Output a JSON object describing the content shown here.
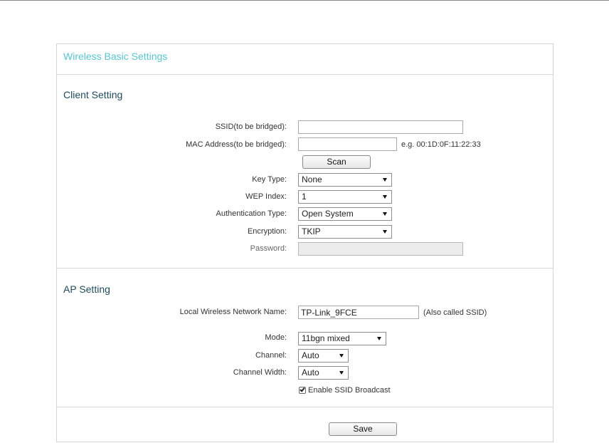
{
  "page": {
    "title": "Wireless Basic Settings"
  },
  "client": {
    "section_title": "Client Setting",
    "ssid_label": "SSID(to be bridged):",
    "ssid_value": "",
    "mac_label": "MAC Address(to be bridged):",
    "mac_value": "",
    "mac_hint": "e.g. 00:1D:0F:11:22:33",
    "scan_label": "Scan",
    "key_type_label": "Key Type:",
    "key_type_value": "None",
    "wep_index_label": "WEP Index:",
    "wep_index_value": "1",
    "auth_type_label": "Authentication Type:",
    "auth_type_value": "Open System",
    "encryption_label": "Encryption:",
    "encryption_value": "TKIP",
    "password_label": "Password:",
    "password_value": ""
  },
  "ap": {
    "section_title": "AP Setting",
    "network_name_label": "Local Wireless Network Name:",
    "network_name_value": "TP-Link_9FCE",
    "network_name_hint": "(Also called SSID)",
    "mode_label": "Mode:",
    "mode_value": "11bgn mixed",
    "channel_label": "Channel:",
    "channel_value": "Auto",
    "channel_width_label": "Channel Width:",
    "channel_width_value": "Auto",
    "broadcast_label": "Enable SSID Broadcast",
    "broadcast_checked": true
  },
  "footer": {
    "save_label": "Save"
  },
  "icons": {
    "dropdown": "chevron-down-icon",
    "checkbox": "checkmark-icon"
  },
  "colors": {
    "title": "#5ac4d2",
    "section_title": "#1f4b5a",
    "border": "#d4d4d4"
  }
}
